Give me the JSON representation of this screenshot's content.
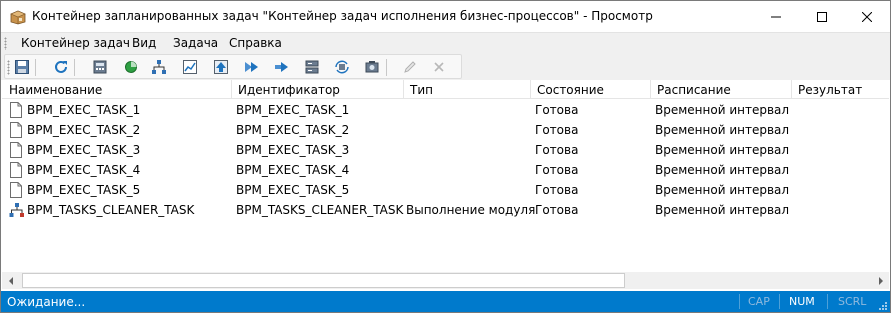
{
  "window": {
    "title": "Контейнер запланированных задач \"Контейнер задач исполнения бизнес-процессов\" - Просмотр"
  },
  "menu": {
    "items": [
      "Контейнер задач",
      "Вид",
      "Задача",
      "Справка"
    ]
  },
  "toolbar": {
    "buttons": [
      {
        "icon": "save-icon"
      },
      {
        "icon": "refresh-icon"
      },
      {
        "icon": "calculator-icon"
      },
      {
        "icon": "status-circle-icon"
      },
      {
        "icon": "hierarchy-icon"
      },
      {
        "icon": "chart-icon"
      },
      {
        "icon": "upload-icon"
      },
      {
        "icon": "fast-forward-icon"
      },
      {
        "icon": "run-icon"
      },
      {
        "icon": "server-icon"
      },
      {
        "icon": "sync-icon"
      },
      {
        "icon": "settings-icon"
      },
      {
        "icon": "edit-icon"
      },
      {
        "icon": "delete-icon"
      }
    ]
  },
  "list": {
    "columns": [
      "Наименование",
      "Идентификатор",
      "Тип",
      "Состояние",
      "Расписание",
      "Результат"
    ],
    "rows": [
      {
        "name": "BPM_EXEC_TASK_1",
        "id": "BPM_EXEC_TASK_1",
        "type": "",
        "state": "Готова",
        "schedule": "Временной интервал",
        "result": "",
        "icon": "document-icon"
      },
      {
        "name": "BPM_EXEC_TASK_2",
        "id": "BPM_EXEC_TASK_2",
        "type": "",
        "state": "Готова",
        "schedule": "Временной интервал",
        "result": "",
        "icon": "document-icon"
      },
      {
        "name": "BPM_EXEC_TASK_3",
        "id": "BPM_EXEC_TASK_3",
        "type": "",
        "state": "Готова",
        "schedule": "Временной интервал",
        "result": "",
        "icon": "document-icon"
      },
      {
        "name": "BPM_EXEC_TASK_4",
        "id": "BPM_EXEC_TASK_4",
        "type": "",
        "state": "Готова",
        "schedule": "Временной интервал",
        "result": "",
        "icon": "document-icon"
      },
      {
        "name": "BPM_EXEC_TASK_5",
        "id": "BPM_EXEC_TASK_5",
        "type": "",
        "state": "Готова",
        "schedule": "Временной интервал",
        "result": "",
        "icon": "document-icon"
      },
      {
        "name": "BPM_TASKS_CLEANER_TASK",
        "id": "BPM_TASKS_CLEANER_TASK",
        "type": "Выполнение модуля",
        "state": "Готова",
        "schedule": "Временной интервал",
        "result": "",
        "icon": "module-icon"
      }
    ]
  },
  "statusbar": {
    "text": "Ожидание...",
    "cap": "CAP",
    "num": "NUM",
    "scrl": "SCRL"
  },
  "colors": {
    "statusbar": "#007acc",
    "accent_blue": "#1e73be"
  }
}
